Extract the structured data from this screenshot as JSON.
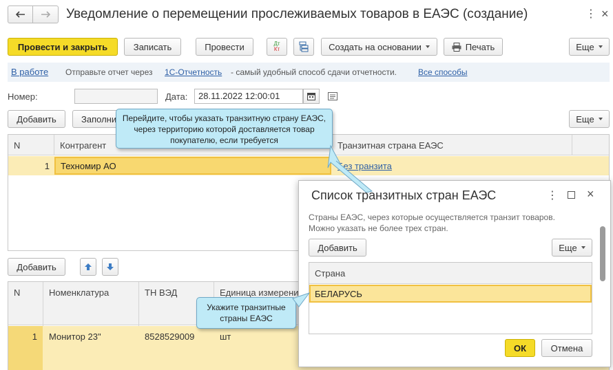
{
  "title": "Уведомление о перемещении прослеживаемых товаров в ЕАЭС (создание)",
  "toolbar": {
    "post_close": "Провести и закрыть",
    "save": "Записать",
    "post": "Провести",
    "create_based": "Создать на основании",
    "print": "Печать",
    "more": "Еще"
  },
  "infobar": {
    "status": "В работе",
    "text_before": "Отправьте отчет через",
    "link1": "1С-Отчетность",
    "text_after": "- самый удобный способ сдачи отчетности.",
    "link2": "Все способы"
  },
  "form": {
    "number_label": "Номер:",
    "number_value": "",
    "date_label": "Дата:",
    "date_value": "28.11.2022 12:00:01"
  },
  "top_table": {
    "add": "Добавить",
    "fill": "Заполни",
    "more": "Еще",
    "headers": {
      "n": "N",
      "counterparty": "Контрагент",
      "transit": "Транзитная страна ЕАЭС"
    },
    "row": {
      "n": "1",
      "counterparty": "Техномир АО",
      "transit": "Без транзита"
    }
  },
  "bottom_table": {
    "add": "Добавить",
    "headers": {
      "n": "N",
      "nomenclature": "Номенклатура",
      "tnved": "ТН ВЭД",
      "unit": "Единица измерени"
    },
    "row": {
      "n": "1",
      "nomenclature": "Монитор 23\"",
      "tnved": "8528529009",
      "unit": "шт"
    }
  },
  "tooltip1": "Перейдите, чтобы указать транзитную страну ЕАЭС, через территорию которой доставляется товар покупателю, если требуется",
  "tooltip2": "Укажите транзитные страны ЕАЭС",
  "dialog": {
    "title": "Список транзитных стран ЕАЭС",
    "description": "Страны ЕАЭС, через которые осуществляется транзит товаров. Можно указать не более трех стран.",
    "add": "Добавить",
    "more": "Еще",
    "column": "Страна",
    "row": "БЕЛАРУСЬ",
    "ok": "ОК",
    "cancel": "Отмена"
  },
  "colors": {
    "accent_yellow": "#f5db28",
    "row_highlight": "#fbecb6",
    "tooltip_bg": "#bfeaf7",
    "link": "#2d5fa6"
  }
}
